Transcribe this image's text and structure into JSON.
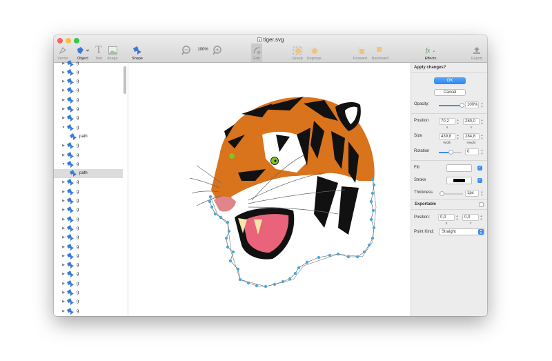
{
  "window": {
    "title": "tiger.svg"
  },
  "toolbar": {
    "vector": "Vector",
    "object": "Object",
    "text": "Text",
    "image": "Image",
    "shape": "Shape",
    "zoom": "100%",
    "edit": "Edit",
    "group": "Group",
    "ungroup": "Ungroup",
    "forward": "Forward",
    "backward": "Backward",
    "effects": "Effects",
    "export": "Export"
  },
  "tree": [
    {
      "label": "g",
      "type": "g",
      "state": "collapsed"
    },
    {
      "label": "g",
      "type": "g",
      "state": "collapsed"
    },
    {
      "label": "g",
      "type": "g",
      "state": "collapsed"
    },
    {
      "label": "g",
      "type": "g",
      "state": "collapsed"
    },
    {
      "label": "g",
      "type": "g",
      "state": "collapsed"
    },
    {
      "label": "g",
      "type": "g",
      "state": "collapsed"
    },
    {
      "label": "g",
      "type": "g",
      "state": "collapsed"
    },
    {
      "label": "g",
      "type": "g",
      "state": "expanded"
    },
    {
      "label": "path",
      "type": "path",
      "state": "leaf"
    },
    {
      "label": "g",
      "type": "g",
      "state": "collapsed"
    },
    {
      "label": "g",
      "type": "g",
      "state": "collapsed"
    },
    {
      "label": "g",
      "type": "g",
      "state": "expanded"
    },
    {
      "label": "path",
      "type": "path",
      "state": "selected"
    },
    {
      "label": "g",
      "type": "g",
      "state": "collapsed"
    },
    {
      "label": "g",
      "type": "g",
      "state": "collapsed"
    },
    {
      "label": "g",
      "type": "g",
      "state": "collapsed"
    },
    {
      "label": "g",
      "type": "g",
      "state": "collapsed"
    },
    {
      "label": "g",
      "type": "g",
      "state": "collapsed"
    },
    {
      "label": "g",
      "type": "g",
      "state": "collapsed"
    },
    {
      "label": "g",
      "type": "g",
      "state": "collapsed"
    },
    {
      "label": "g",
      "type": "g",
      "state": "collapsed"
    },
    {
      "label": "g",
      "type": "g",
      "state": "collapsed"
    },
    {
      "label": "g",
      "type": "g",
      "state": "collapsed"
    },
    {
      "label": "g",
      "type": "g",
      "state": "collapsed"
    },
    {
      "label": "g",
      "type": "g",
      "state": "collapsed"
    },
    {
      "label": "g",
      "type": "g",
      "state": "collapsed"
    },
    {
      "label": "g",
      "type": "g",
      "state": "collapsed"
    },
    {
      "label": "g",
      "type": "g",
      "state": "collapsed"
    }
  ],
  "inspector": {
    "header": "Apply changes?",
    "ok": "OK",
    "cancel": "Cancel",
    "opacity_label": "Opacity:",
    "opacity_value": "100%",
    "opacity_fraction": 1.0,
    "position_label": "Position",
    "pos_x": "70,2",
    "pos_y": "280,0",
    "x_label": "X",
    "y_label": "Y",
    "size_label": "Size",
    "width": "439,8",
    "height": "284,8",
    "width_label": "Width",
    "height_label": "Height",
    "rotation_label": "Rotation",
    "rotation_value": "0",
    "rotation_fraction": 0.5,
    "fill_label": "Fill",
    "fill_color": "#ffffff",
    "fill_checked": true,
    "stroke_label": "Stroke",
    "stroke_color": "#000000",
    "stroke_checked": true,
    "thickness_label": "Thickness",
    "thickness_value": "1px",
    "exportable_label": "Exportable",
    "exportable_checked": false,
    "point_position_label": "Position:",
    "point_x": "0,0",
    "point_y": "0,0",
    "point_kind_label": "Point Kind:",
    "point_kind_value": "Straight"
  },
  "colors": {
    "accent": "#3d8ef0",
    "node": "#4aa8dc",
    "orange": "#d9731c"
  }
}
